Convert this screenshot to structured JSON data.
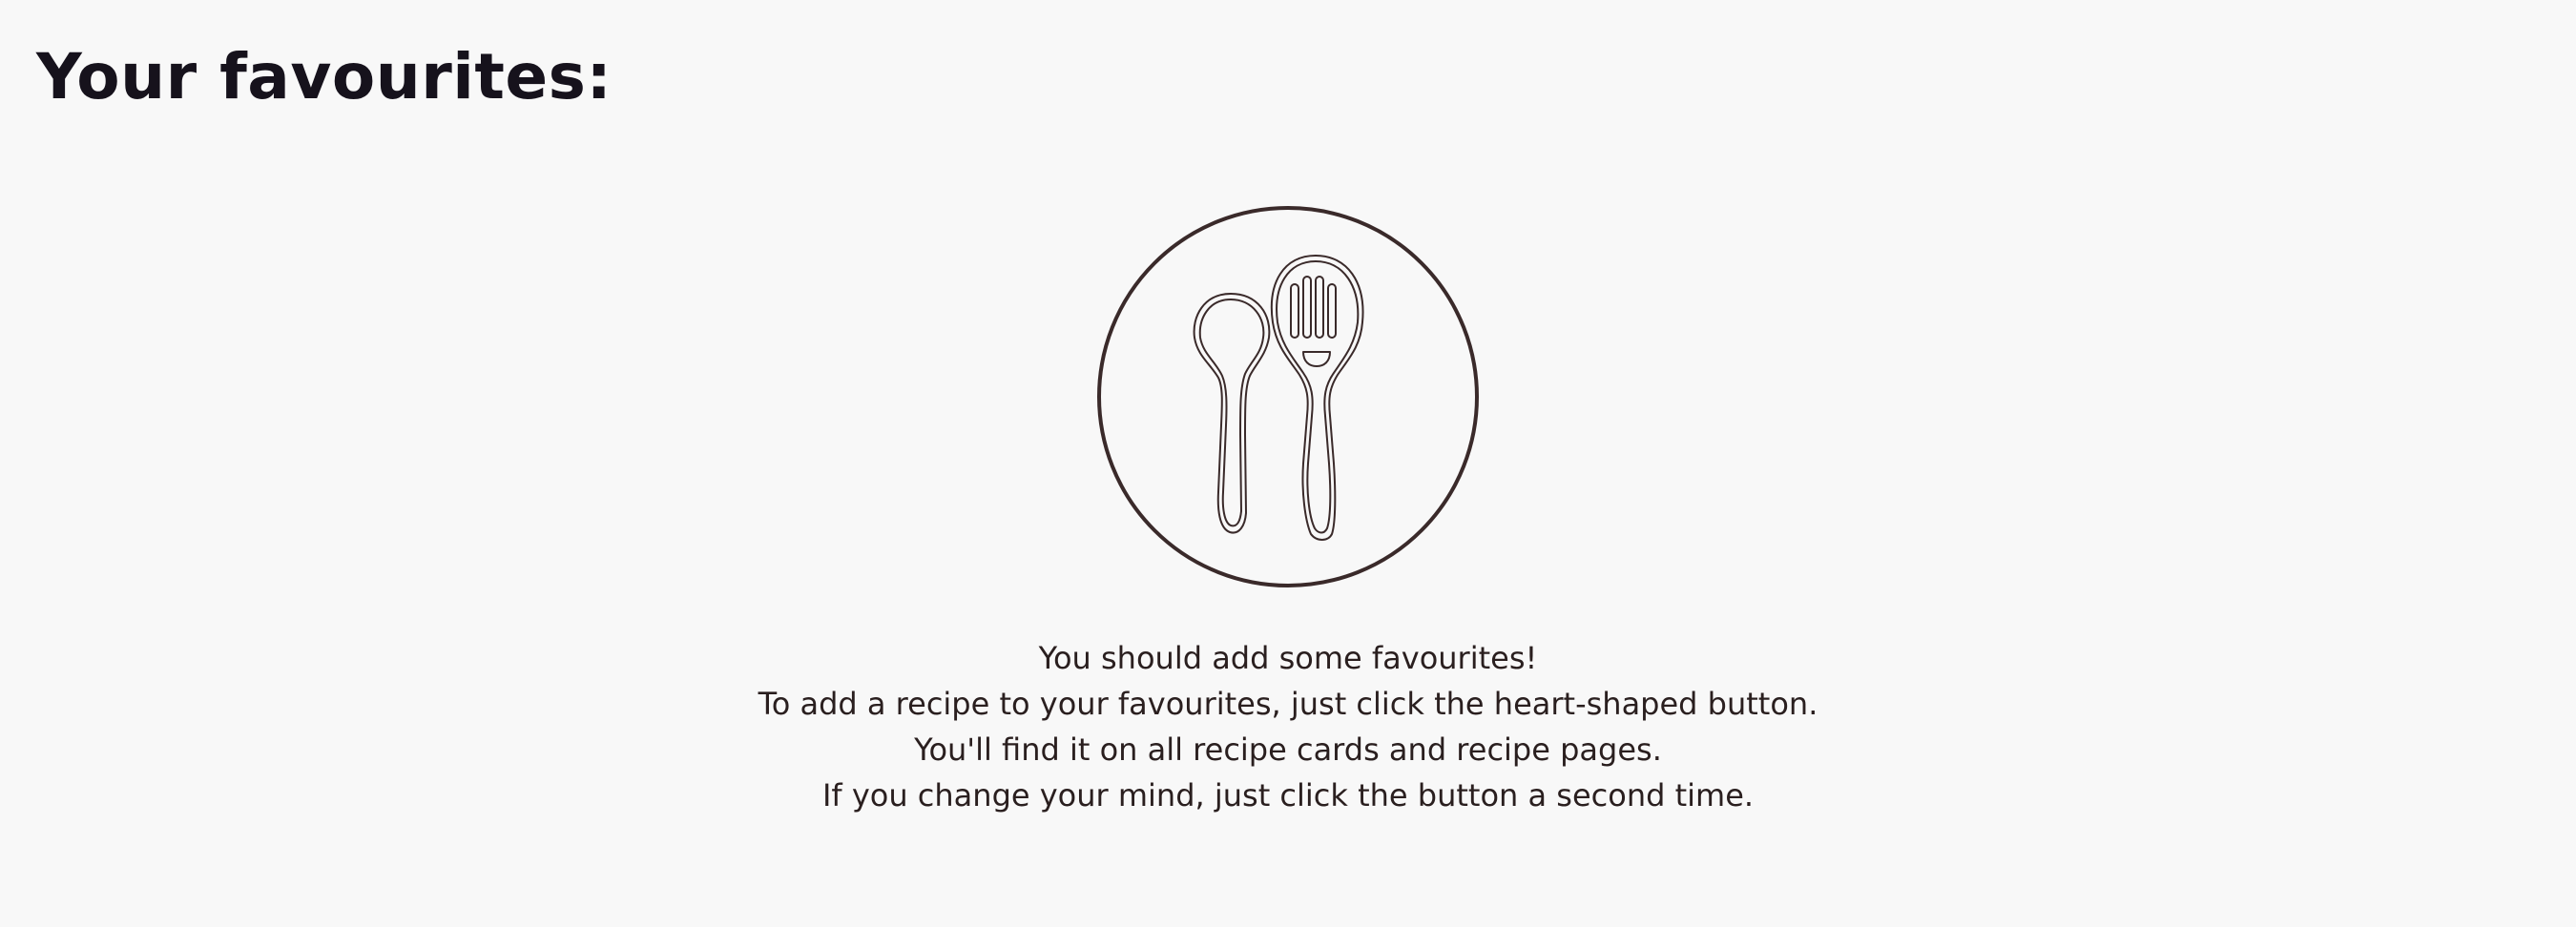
{
  "page": {
    "title": "Your favourites:"
  },
  "empty_state": {
    "illustration_icon": "spoon-and-slotted-spoon-icon",
    "lines": [
      "You should add some favourites!",
      "To add a recipe to your favourites, just click the heart-shaped button.",
      "You'll find it on all recipe cards and recipe pages.",
      "If you change your mind, just click the button a second time."
    ]
  },
  "colors": {
    "background": "#f8f8f8",
    "title": "#16121c",
    "text": "#2a1f1f",
    "illustration_stroke": "#3a2a2a"
  }
}
